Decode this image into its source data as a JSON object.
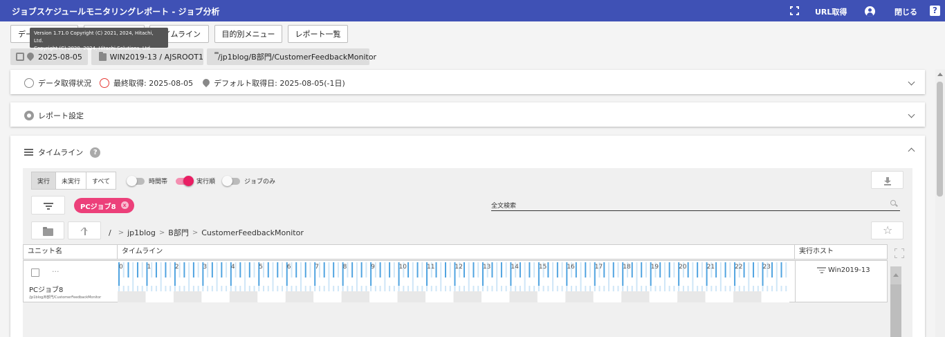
{
  "header": {
    "title": "ジョブスケジュールモニタリングレポート - ジョブ分析",
    "url_label": "URL取得",
    "close_label": "閉じる",
    "help": "?"
  },
  "toolbar": {
    "btn1": "デー",
    "btn2": "",
    "btn3": "イムライン",
    "btn4": "目的別メニュー",
    "btn5": "レポート一覧"
  },
  "tooltip": {
    "line1": "Version 1.71.0 Copyright (C) 2021, 2024, Hitachi, Ltd.",
    "line2": "Copyright (C) 2020, 2024, Hitachi Solutions, Ltd."
  },
  "chips": {
    "date": "2025-08-05",
    "host": "WIN2019-13 / AJSROOT1",
    "path": "/jp1blog/B部門/CustomerFeedbackMonitor"
  },
  "status_panel": {
    "data_status": "データ取得状況",
    "last_fetch": "最終取得: 2025-08-05",
    "default_fetch": "デフォルト取得日: 2025-08-05(-1日)"
  },
  "report_panel": {
    "label": "レポート設定"
  },
  "timeline_panel": {
    "label": "タイムライン",
    "help": "?",
    "segments": [
      "実行",
      "未実行",
      "すべて"
    ],
    "toggles": [
      {
        "label": "時間帯",
        "on": false
      },
      {
        "label": "実行順",
        "on": true
      },
      {
        "label": "ジョブのみ",
        "on": false
      }
    ],
    "filter_chip": "PCジョブ8",
    "filter_chip_x": "x",
    "search_label": "全文検索",
    "crumb_root": "/",
    "crumbs": [
      "jp1blog",
      "B部門",
      "CustomerFeedbackMonitor"
    ],
    "columns": [
      "ユニット名",
      "タイムライン",
      "実行ホスト"
    ],
    "row": {
      "unit_name": "PCジョブ8",
      "unit_path": "/jp1blog/B部門/CustomerFeedbackMonitor",
      "ellipsis": "...",
      "host": "Win2019-13"
    },
    "hour_ticks": [
      "0",
      "1",
      "2",
      "3",
      "4",
      "5",
      "6",
      "7",
      "8",
      "9",
      "10",
      "11",
      "12",
      "13",
      "14",
      "15",
      "16",
      "17",
      "18",
      "19",
      "20",
      "21",
      "22",
      "23"
    ]
  },
  "colors": {
    "header_bg": "#3f51b5",
    "accent_pink": "#ec407a",
    "bar_blue": "#4fa3e0",
    "bar_light": "#cfe6f7"
  }
}
